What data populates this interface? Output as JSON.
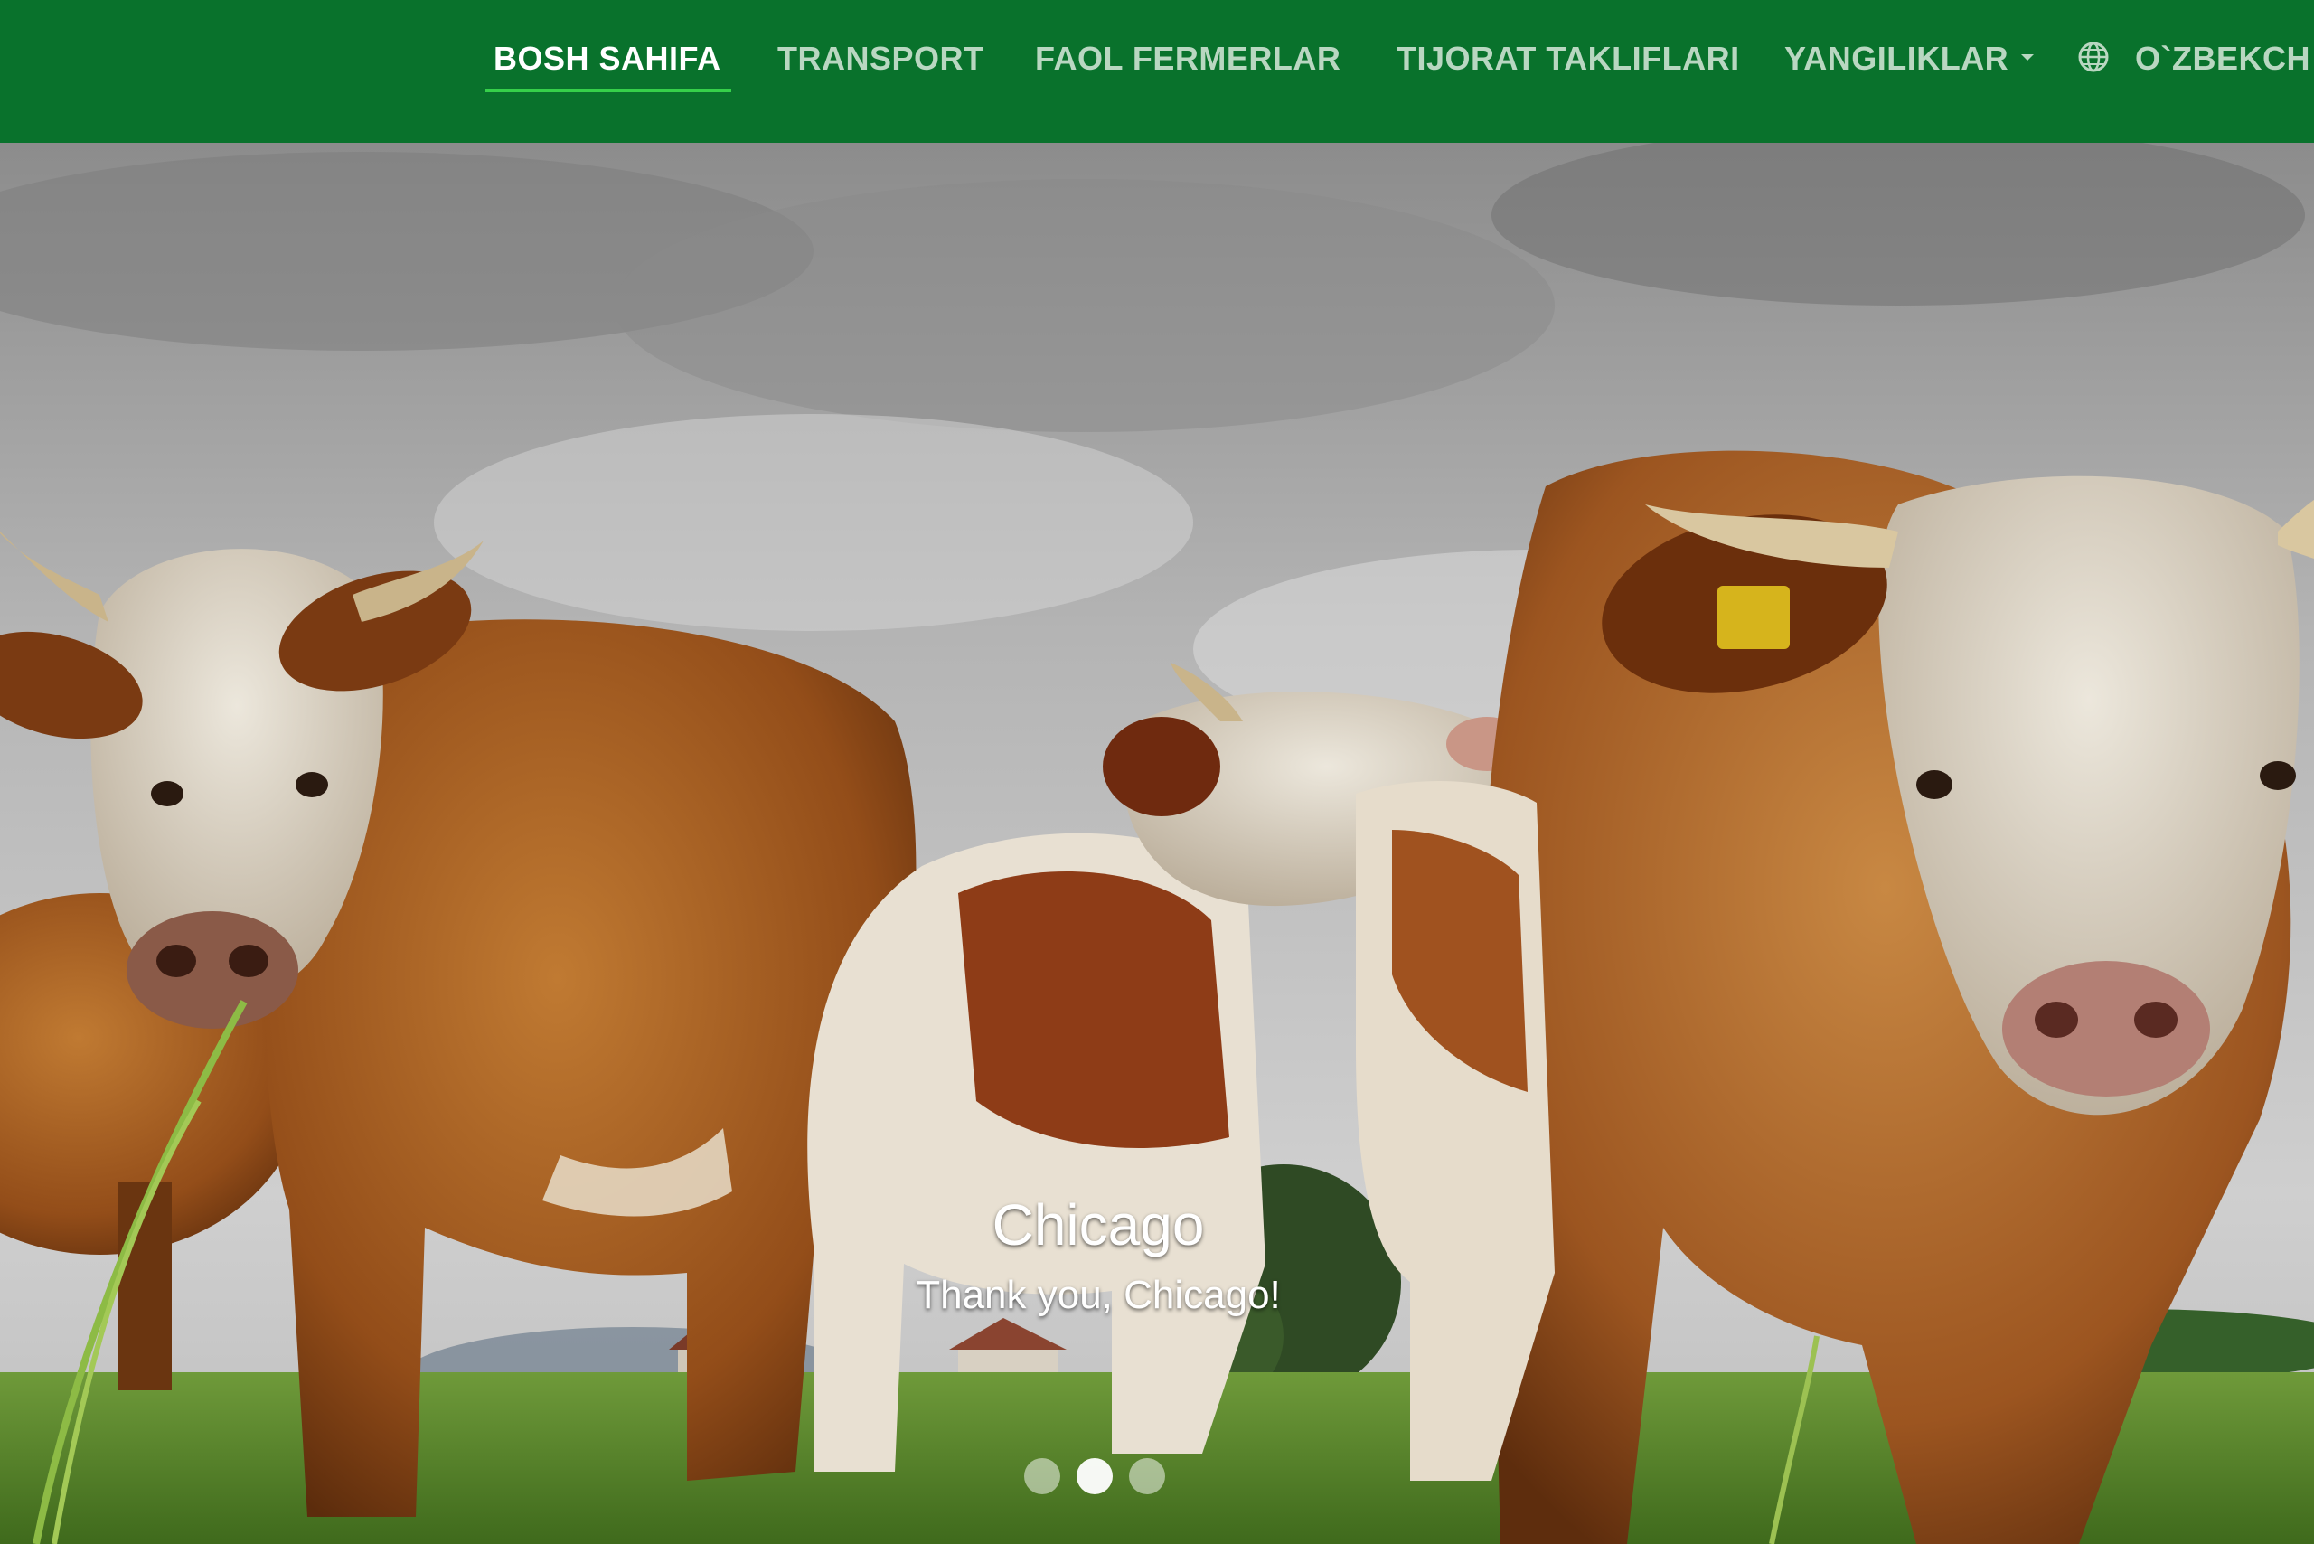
{
  "nav": {
    "items": [
      {
        "label": "BOSH SAHIFA",
        "active": true
      },
      {
        "label": "TRANSPORT",
        "active": false
      },
      {
        "label": "FAOL FERMERLAR",
        "active": false
      },
      {
        "label": "TIJORAT TAKLIFLARI",
        "active": false
      },
      {
        "label": "YANGILIKLAR",
        "active": false,
        "dropdown": true
      }
    ],
    "language": {
      "label": "O`ZBEKCH",
      "icon": "globe-icon"
    }
  },
  "carousel": {
    "title": "Chicago",
    "subtitle": "Thank you, Chicago!",
    "slide_count": 3,
    "active_index": 1
  },
  "colors": {
    "navbar_bg": "#09722c",
    "nav_text": "#b9d7c1",
    "nav_active_text": "#ffffff",
    "nav_underline": "#36d04a"
  }
}
